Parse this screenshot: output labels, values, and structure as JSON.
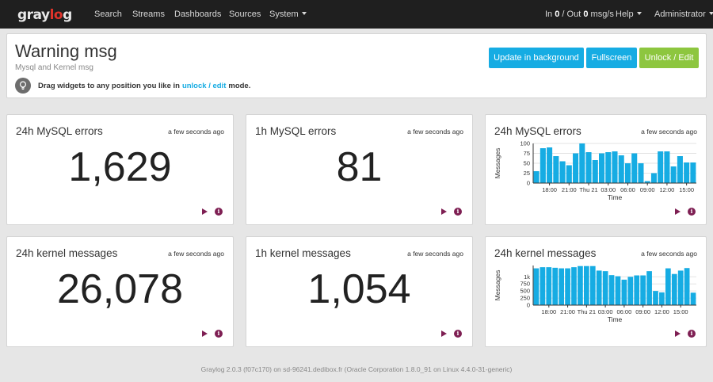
{
  "nav": {
    "logo_prefix": "gray",
    "logo_o": "lo",
    "logo_suffix": "g",
    "items": [
      "Search",
      "Streams",
      "Dashboards",
      "Sources"
    ],
    "system": "System",
    "throughput": {
      "in_label": "In",
      "in_value": "0",
      "out_label": "Out",
      "out_value": "0",
      "unit": "msg/s"
    },
    "help": "Help",
    "user": "Administrator"
  },
  "header": {
    "title": "Warning msg",
    "subtitle": "Mysql and Kernel msg",
    "hint_before": "Drag widgets to any position you like in",
    "hint_link": "unlock / edit",
    "hint_after": "mode.",
    "buttons": {
      "update": "Update in background",
      "fullscreen": "Fullscreen",
      "unlock": "Unlock / Edit"
    }
  },
  "widgets": [
    {
      "title": "24h MySQL errors",
      "time": "a few seconds ago",
      "value": "1,629"
    },
    {
      "title": "1h MySQL errors",
      "time": "a few seconds ago",
      "value": "81"
    },
    {
      "title": "24h MySQL errors",
      "time": "a few seconds ago"
    },
    {
      "title": "24h kernel messages",
      "time": "a few seconds ago",
      "value": "26,078"
    },
    {
      "title": "1h kernel messages",
      "time": "a few seconds ago",
      "value": "1,054"
    },
    {
      "title": "24h kernel messages",
      "time": "a few seconds ago"
    }
  ],
  "colors": {
    "bar": "#16ace3",
    "accent": "#16ace3",
    "success": "#8dc63f",
    "action": "#7e1f53"
  },
  "icons": {
    "hint": "lightbulb-icon",
    "play": "play-icon",
    "info": "info-icon"
  },
  "chart_data": [
    {
      "type": "bar",
      "title": "24h MySQL errors",
      "xlabel": "Time",
      "ylabel": "Messages",
      "ylim": [
        0,
        100
      ],
      "yticks": [
        0,
        25,
        50,
        75,
        100
      ],
      "ytick_labels": [
        "0",
        "25",
        "50",
        "75",
        "100"
      ],
      "xticks": [
        3.5,
        6.5,
        9.5,
        12.5,
        15.5,
        18.5,
        21.5
      ],
      "xtick_labels": [
        "18:00",
        "21:00",
        "Thu 21",
        "03:00",
        "06:00",
        "09:00",
        "12:00",
        "15:00"
      ],
      "xtick_positions": [
        2.5,
        5.5,
        8.5,
        11.5,
        14.5,
        17.5,
        20.5,
        23.5
      ],
      "values": [
        30,
        88,
        90,
        68,
        55,
        45,
        75,
        100,
        78,
        58,
        75,
        78,
        80,
        70,
        50,
        75,
        50,
        5,
        25,
        80,
        80,
        42,
        68,
        52,
        52
      ]
    },
    {
      "type": "bar",
      "title": "24h kernel messages",
      "xlabel": "Time",
      "ylabel": "Messages",
      "ylim": [
        0,
        1400
      ],
      "yticks": [
        0,
        250,
        500,
        750,
        1000
      ],
      "ytick_labels": [
        "0",
        "250",
        "500",
        "750",
        "1k"
      ],
      "xtick_labels": [
        "18:00",
        "21:00",
        "Thu 21",
        "03:00",
        "06:00",
        "09:00",
        "12:00",
        "15:00"
      ],
      "xtick_positions": [
        2.5,
        5.5,
        8.5,
        11.5,
        14.5,
        17.5,
        20.5,
        23.5
      ],
      "values": [
        1300,
        1340,
        1340,
        1320,
        1300,
        1300,
        1340,
        1380,
        1380,
        1380,
        1220,
        1200,
        1060,
        1020,
        900,
        1000,
        1050,
        1050,
        1200,
        500,
        450,
        1300,
        1100,
        1220,
        1310,
        440
      ]
    }
  ]
}
